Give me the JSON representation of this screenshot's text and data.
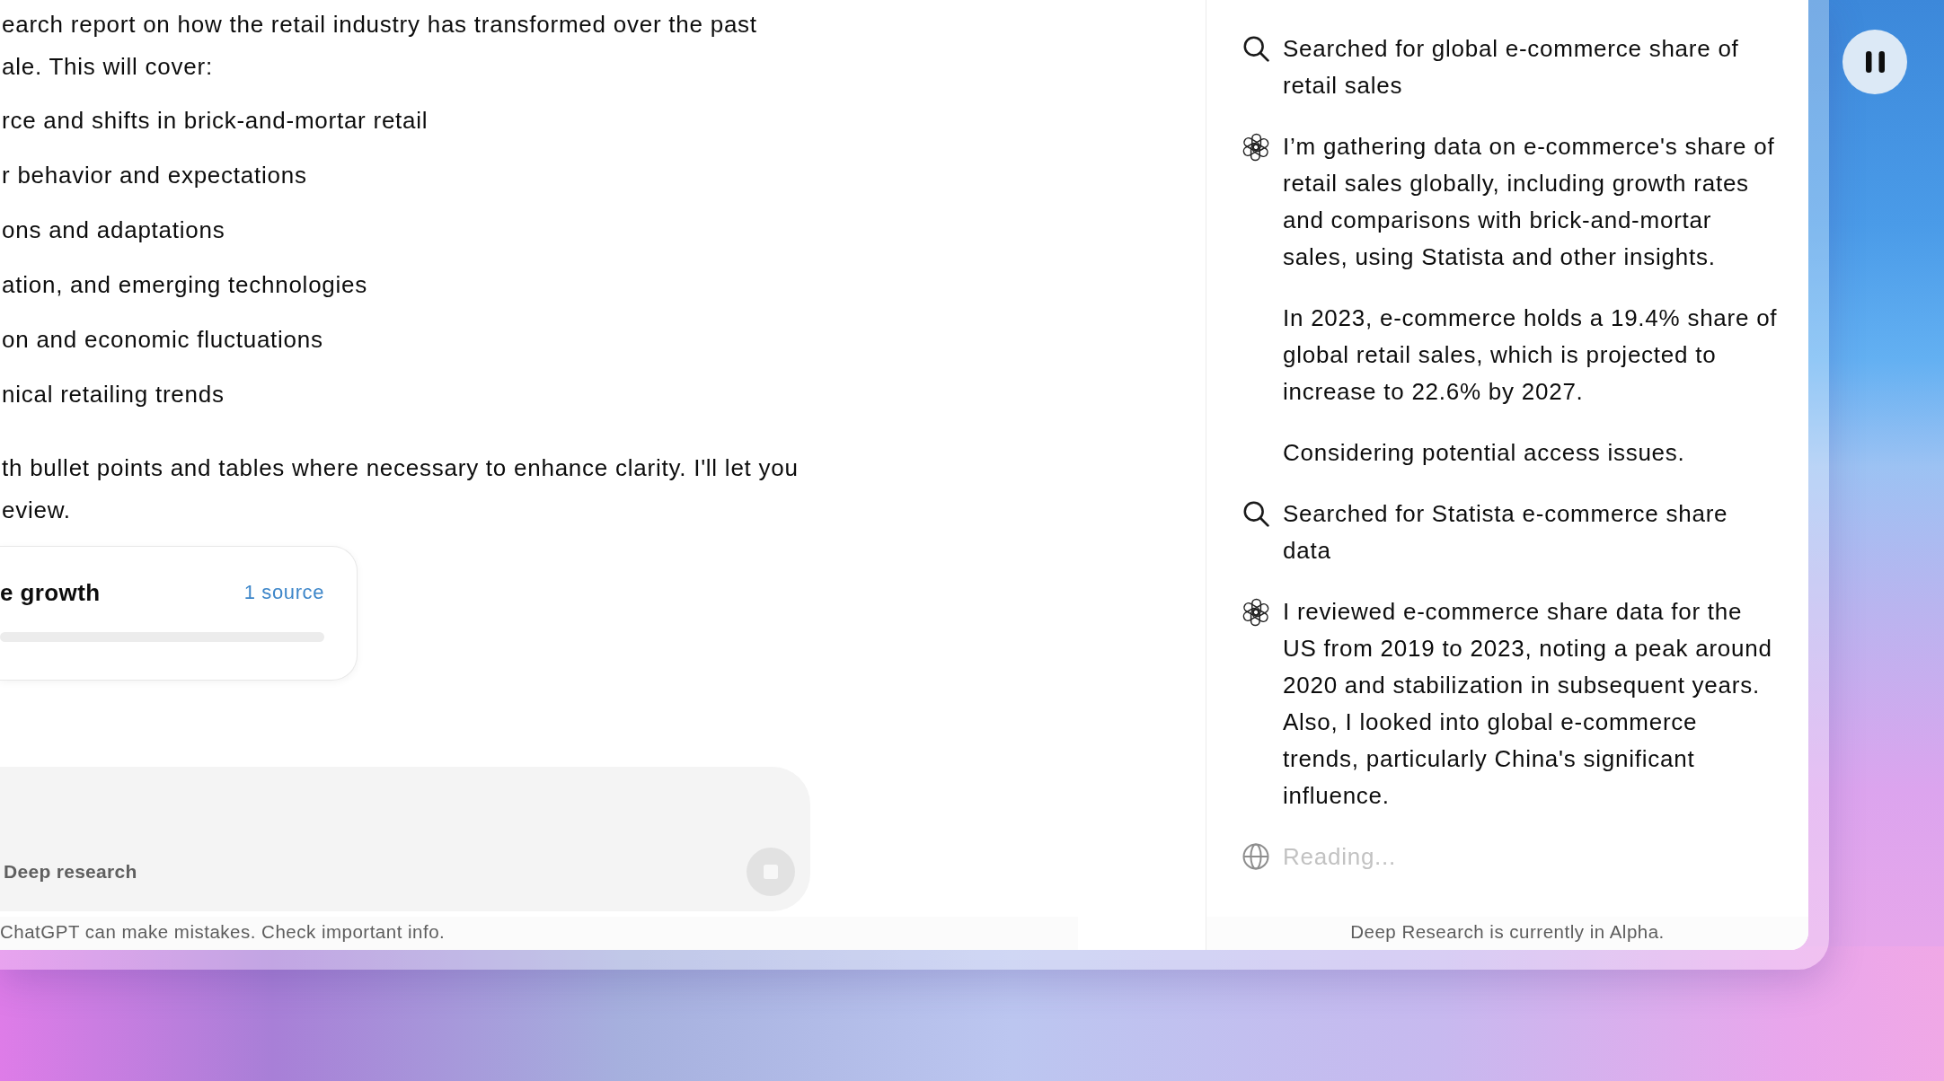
{
  "chat": {
    "intro": "earch report on how the retail industry has transformed over the past ale. This will cover:",
    "bullets": [
      "rce and shifts in brick-and-mortar retail",
      "r behavior and expectations",
      "ons and adaptations",
      "ation, and emerging technologies",
      "on and economic fluctuations",
      "nical retailing trends"
    ],
    "closing": "th bullet points and tables where necessary to enhance clarity. I'll let you eview.",
    "source_card": {
      "title": "e growth",
      "sources": "1 source"
    }
  },
  "composer": {
    "mode": "Deep research",
    "stop_button": {
      "disabled": true
    }
  },
  "footer_note": "ChatGPT can make mistakes. Check important info.",
  "activity": {
    "items": [
      {
        "kind": "search",
        "paragraphs": [
          "Searched for global e-commerce share of retail sales"
        ]
      },
      {
        "kind": "thought",
        "paragraphs": [
          "I’m gathering data on e-commerce's share of retail sales globally, including growth rates and comparisons with brick-and-mortar sales, using Statista and other insights.",
          "In 2023, e-commerce holds a 19.4% share of global retail sales, which is projected to increase to 22.6% by 2027.",
          "Considering potential access issues."
        ]
      },
      {
        "kind": "search",
        "paragraphs": [
          "Searched for Statista e-commerce share data"
        ]
      },
      {
        "kind": "thought",
        "paragraphs": [
          "I reviewed e-commerce share data for the US from 2019 to 2023, noting a peak around 2020 and stabilization in subsequent years. Also, I looked into global e-commerce trends, particularly China's significant influence."
        ]
      },
      {
        "kind": "reading",
        "paragraphs": [
          "Reading..."
        ]
      }
    ],
    "footer": "Deep Research is currently in Alpha."
  }
}
